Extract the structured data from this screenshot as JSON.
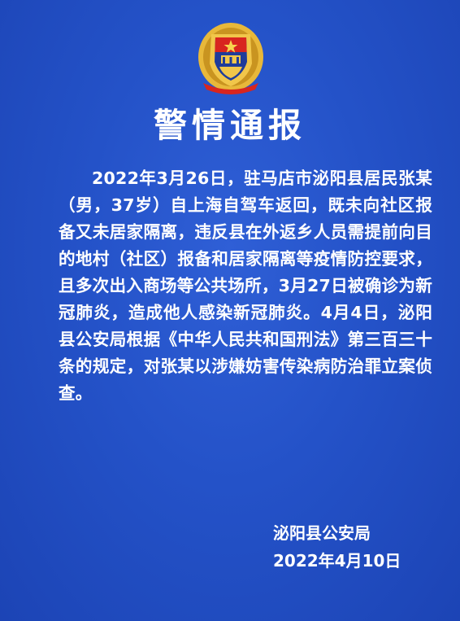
{
  "notice": {
    "title": "警情通报",
    "body": "2022年3月26日，驻马店市泌阳县居民张某（男，37岁）自上海自驾车返回，既未向社区报备又未居家隔离，违反县在外返乡人员需提前向目的地村（社区）报备和居家隔离等疫情防控要求，且多次出入商场等公共场所，3月27日被确诊为新冠肺炎，造成他人感染新冠肺炎。4月4日，泌阳县公安局根据《中华人民共和国刑法》第三百三十条的规定，对张某以涉嫌妨害传染病防治罪立案侦查。",
    "signature_org": "泌阳县公安局",
    "signature_date": "2022年4月10日"
  },
  "emblem": {
    "icon": "police-emblem-icon"
  },
  "colors": {
    "background": "#2452c8",
    "text": "#ffffff",
    "emblem_gold": "#e8b83a",
    "emblem_red": "#d8251f"
  }
}
